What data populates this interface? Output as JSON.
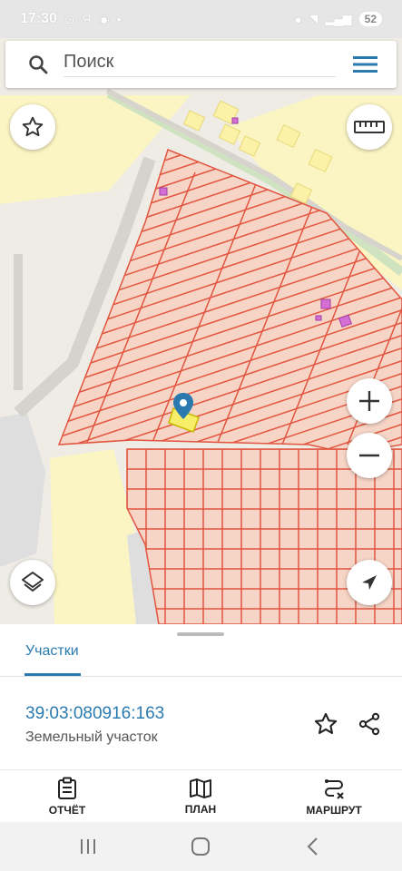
{
  "status_bar": {
    "time": "17:30",
    "left_icons": "⊙ Я ◉ •",
    "battery": "52"
  },
  "search": {
    "placeholder": "Поиск"
  },
  "map": {
    "buttons": [
      "favorite",
      "ruler",
      "zoom-in",
      "zoom-out",
      "layers",
      "my-location"
    ],
    "accent_color": "#2a7ab0",
    "parcel_line_color": "#e2553f",
    "parcel_fill_color": "#f5d3c6",
    "selected_parcel_color": "#f7ee6a"
  },
  "panel": {
    "tab_label": "Участки",
    "parcel_id": "39:03:080916:163",
    "parcel_type": "Земельный участок"
  },
  "bottom_nav": {
    "report": "ОТЧЁТ",
    "plan": "ПЛАН",
    "route": "МАРШРУТ"
  }
}
